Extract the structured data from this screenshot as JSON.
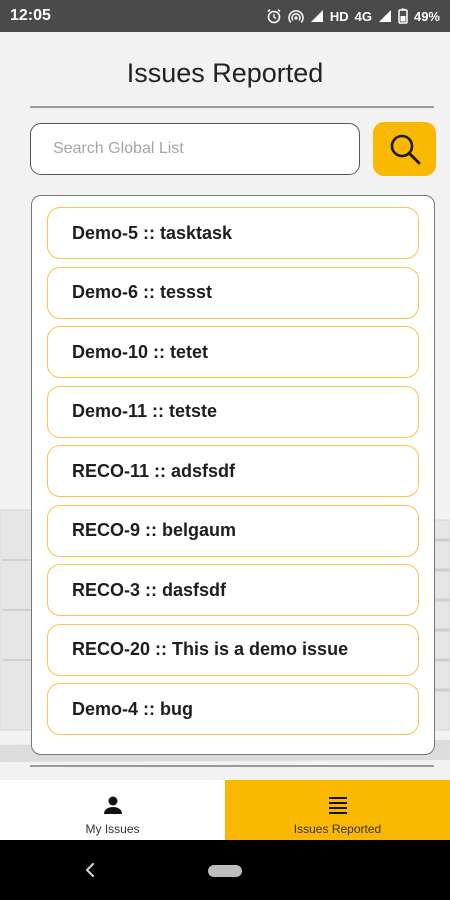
{
  "status_bar": {
    "time": "12:05",
    "network": "HD",
    "network_type": "4G",
    "battery": "49%"
  },
  "header": {
    "title": "Issues Reported"
  },
  "search": {
    "placeholder": "Search Global List"
  },
  "issues": [
    "Demo-5 :: tasktask",
    "Demo-6 :: tessst",
    "Demo-10 :: tetet",
    "Demo-11 :: tetste",
    "RECO-11 :: adsfsdf",
    "RECO-9 :: belgaum",
    "RECO-3 :: dasfsdf",
    "RECO-20 :: This is a demo issue",
    "Demo-4 :: bug"
  ],
  "bottom_nav": {
    "tabs": [
      {
        "label": "My Issues",
        "icon": "person-icon",
        "active": false
      },
      {
        "label": "Issues Reported",
        "icon": "list-icon",
        "active": true
      }
    ]
  },
  "colors": {
    "accent": "#fbb800",
    "item_border": "#fdc24a",
    "status_bar": "#4a4a4a"
  }
}
